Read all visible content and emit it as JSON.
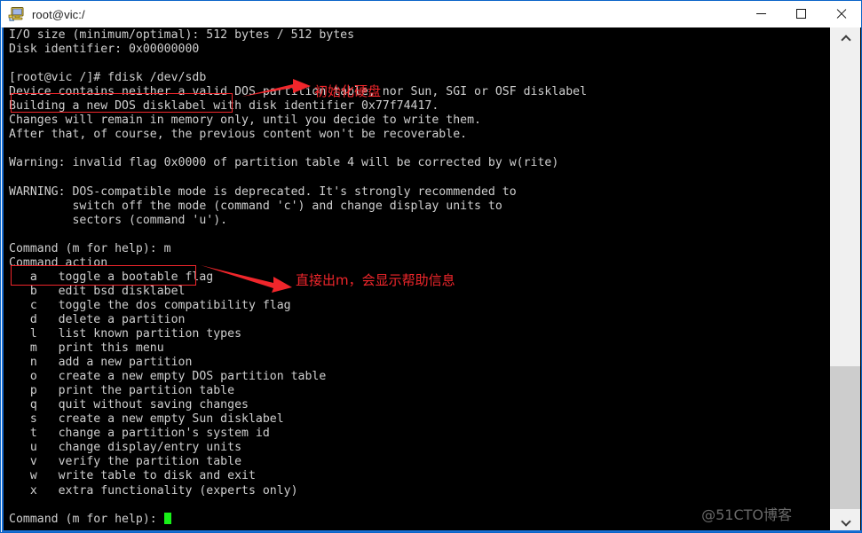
{
  "window": {
    "title": "root@vic:/",
    "icon": "putty-terminal-icon",
    "controls": {
      "minimize": "—",
      "maximize": "□",
      "close": "✕"
    }
  },
  "terminal": {
    "prompt_cursor": "block-cursor",
    "cursor_color": "#18f018",
    "background": "#000000",
    "foreground": "#cfcfcf",
    "lines": [
      "I/O size (minimum/optimal): 512 bytes / 512 bytes",
      "Disk identifier: 0x00000000",
      "",
      "[root@vic /]# fdisk /dev/sdb",
      "Device contains neither a valid DOS partition table, nor Sun, SGI or OSF disklabel",
      "Building a new DOS disklabel with disk identifier 0x77f74417.",
      "Changes will remain in memory only, until you decide to write them.",
      "After that, of course, the previous content won't be recoverable.",
      "",
      "Warning: invalid flag 0x0000 of partition table 4 will be corrected by w(rite)",
      "",
      "WARNING: DOS-compatible mode is deprecated. It's strongly recommended to",
      "         switch off the mode (command 'c') and change display units to",
      "         sectors (command 'u').",
      "",
      "Command (m for help): m",
      "Command action",
      "   a   toggle a bootable flag",
      "   b   edit bsd disklabel",
      "   c   toggle the dos compatibility flag",
      "   d   delete a partition",
      "   l   list known partition types",
      "   m   print this menu",
      "   n   add a new partition",
      "   o   create a new empty DOS partition table",
      "   p   print the partition table",
      "   q   quit without saving changes",
      "   s   create a new empty Sun disklabel",
      "   t   change a partition's system id",
      "   u   change display/entry units",
      "   v   verify the partition table",
      "   w   write table to disk and exit",
      "   x   extra functionality (experts only)",
      "",
      "Command (m for help): "
    ]
  },
  "annotations": {
    "color": "#f0262b",
    "items": [
      {
        "text": "初始化硬盘",
        "highlights": "[root@vic /]# fdisk /dev/sdb"
      },
      {
        "text": "直接出m，会显示帮助信息",
        "highlights": "Command (m for help): m"
      }
    ]
  },
  "scrollbar": {
    "up_arrow": "chevron-up-icon",
    "down_arrow": "chevron-down-icon",
    "thumb": "scrollbar-thumb"
  },
  "watermark": {
    "text": "@51CTO博客"
  }
}
